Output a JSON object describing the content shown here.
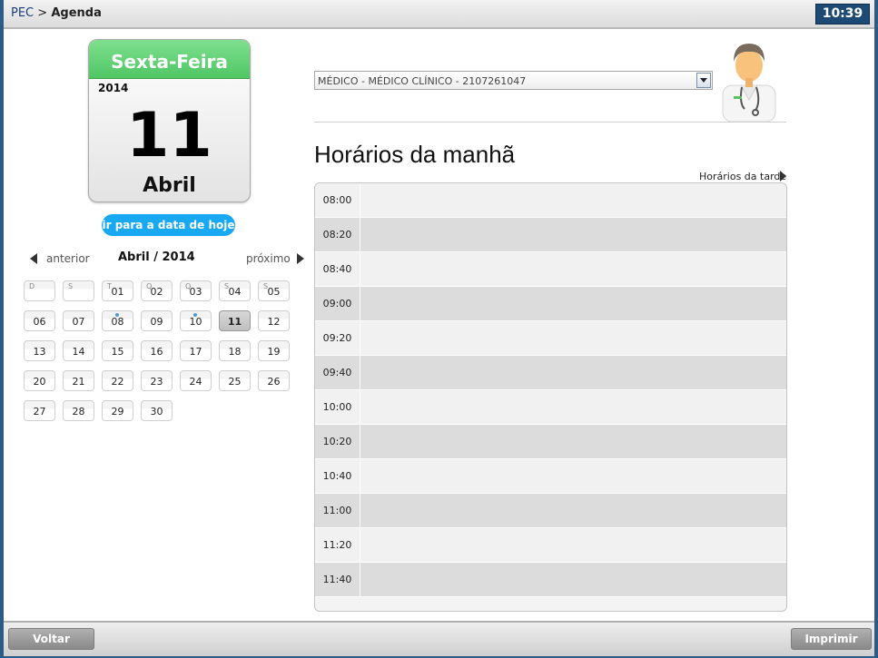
{
  "header": {
    "breadcrumb_root": "PEC",
    "breadcrumb_separator": ">",
    "breadcrumb_current": "Agenda",
    "clock": "10:39"
  },
  "big_calendar": {
    "weekday": "Sexta-Feira",
    "year": "2014",
    "day": "11",
    "month": "Abril"
  },
  "today_button": "ir para a data de hoje",
  "month_nav": {
    "prev": "anterior",
    "current": "Abril / 2014",
    "next": "próximo"
  },
  "mini_calendar": {
    "rows": [
      [
        {
          "wd": "D",
          "d": ""
        },
        {
          "wd": "S",
          "d": ""
        },
        {
          "wd": "T",
          "d": "01"
        },
        {
          "wd": "Q",
          "d": "02"
        },
        {
          "wd": "Q",
          "d": "03"
        },
        {
          "wd": "S",
          "d": "04"
        },
        {
          "wd": "S",
          "d": "05"
        }
      ],
      [
        {
          "d": "06"
        },
        {
          "d": "07"
        },
        {
          "d": "08",
          "dot": true
        },
        {
          "d": "09"
        },
        {
          "d": "10",
          "dot": true
        },
        {
          "d": "11",
          "selected": true
        },
        {
          "d": "12"
        }
      ],
      [
        {
          "d": "13"
        },
        {
          "d": "14"
        },
        {
          "d": "15"
        },
        {
          "d": "16"
        },
        {
          "d": "17"
        },
        {
          "d": "18"
        },
        {
          "d": "19"
        }
      ],
      [
        {
          "d": "20"
        },
        {
          "d": "21"
        },
        {
          "d": "22"
        },
        {
          "d": "23"
        },
        {
          "d": "24"
        },
        {
          "d": "25"
        },
        {
          "d": "26"
        }
      ],
      [
        {
          "d": "27"
        },
        {
          "d": "28"
        },
        {
          "d": "29"
        },
        {
          "d": "30"
        }
      ]
    ]
  },
  "doctor_select": {
    "value": "MÉDICO - MÉDICO CLÍNICO - 2107261047",
    "icon": "chevron-down-icon"
  },
  "doctor_avatar_icon": "doctor-icon",
  "schedule": {
    "title": "Horários da manhã",
    "afternoon_link": "Horários da tarde",
    "slots": [
      "08:00",
      "08:20",
      "08:40",
      "09:00",
      "09:20",
      "09:40",
      "10:00",
      "10:20",
      "10:40",
      "11:00",
      "11:20",
      "11:40"
    ]
  },
  "footer": {
    "back": "Voltar",
    "print": "Imprimir"
  },
  "colors": {
    "weekday_header": "#4fc664",
    "today_button": "#19a9f3",
    "clock_bg": "#1d4a74",
    "window_border": "#2c5b88"
  }
}
